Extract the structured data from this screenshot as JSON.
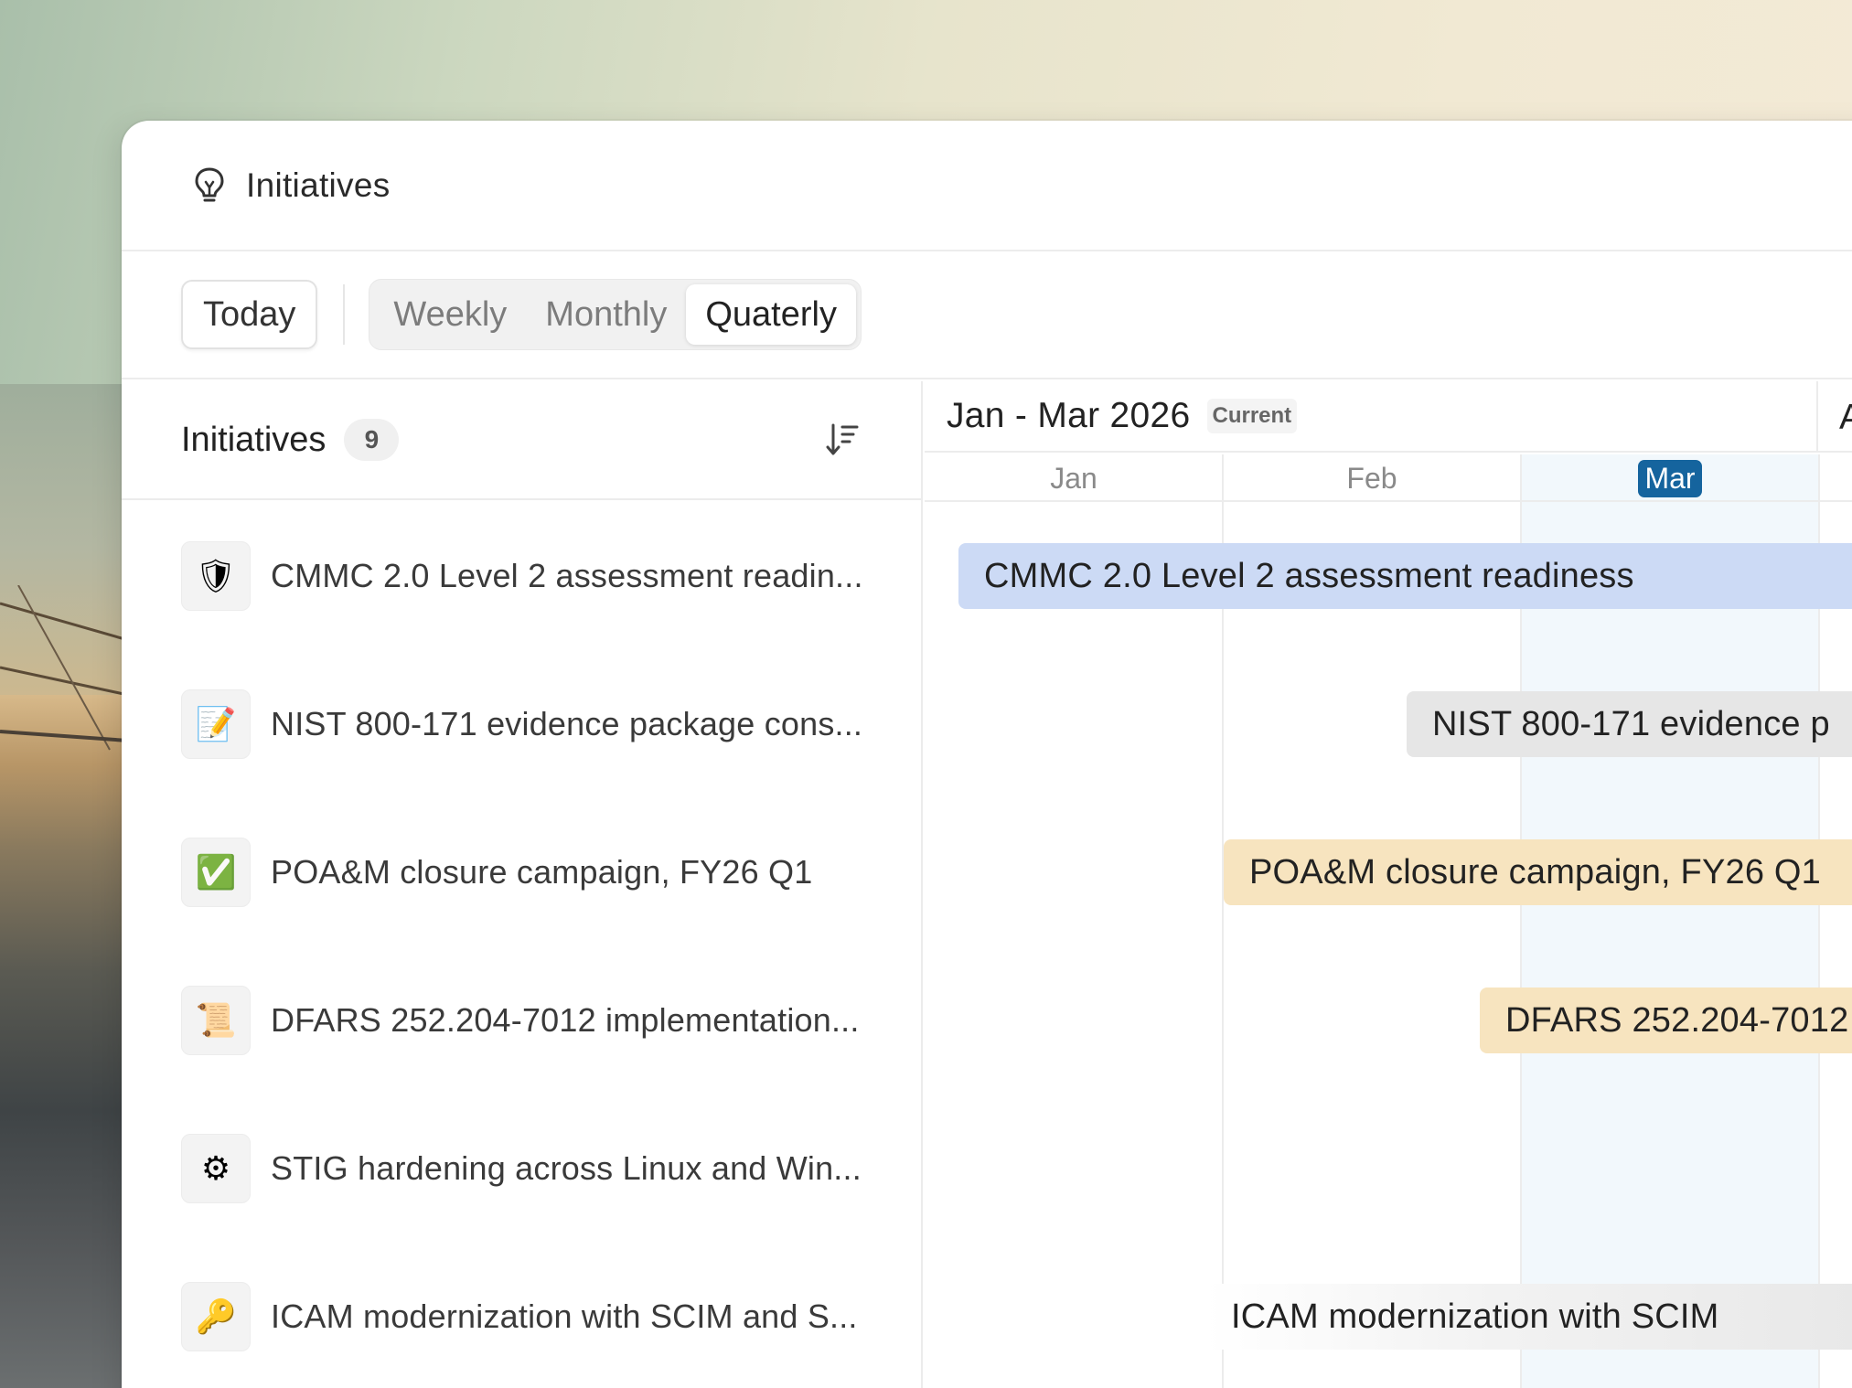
{
  "window": {
    "title": "Initiatives"
  },
  "toolbar": {
    "today_label": "Today",
    "views": [
      {
        "label": "Weekly",
        "active": false
      },
      {
        "label": "Monthly",
        "active": false
      },
      {
        "label": "Quaterly",
        "active": true
      }
    ]
  },
  "list": {
    "title": "Initiatives",
    "count": "9",
    "items": [
      {
        "icon": "shield-icon",
        "glyph": "🛡",
        "label": "CMMC 2.0 Level 2 assessment readin..."
      },
      {
        "icon": "memo-icon",
        "glyph": "📝",
        "label": "NIST 800-171 evidence package cons..."
      },
      {
        "icon": "check-mark-icon",
        "glyph": "✅",
        "label": "POA&M closure campaign, FY26 Q1"
      },
      {
        "icon": "scroll-icon",
        "glyph": "📜",
        "label": "DFARS 252.204-7012 implementation..."
      },
      {
        "icon": "gear-icon",
        "glyph": "⚙",
        "label": "STIG hardening across Linux and Win..."
      },
      {
        "icon": "key-icon",
        "glyph": "🔑",
        "label": "ICAM modernization with SCIM and S..."
      }
    ]
  },
  "timeline": {
    "period": "Jan - Mar 2026",
    "period_tag": "Current",
    "next_period_initial": "A",
    "months": [
      "Jan",
      "Feb",
      "Mar"
    ],
    "current_month": "Mar",
    "bars": [
      {
        "label": "CMMC 2.0 Level 2 assessment readiness",
        "color": "#ccdaf5"
      },
      {
        "label": "NIST 800-171 evidence p",
        "color": "#e6e6e6"
      },
      {
        "label": "POA&M closure campaign, FY26 Q1",
        "color": "#f7e4bf"
      },
      {
        "label": "DFARS 252.204-7012",
        "color": "#f7e4bf"
      },
      {
        "label": "ICAM modernization with SCIM",
        "color": "#e6e6e6"
      }
    ]
  }
}
